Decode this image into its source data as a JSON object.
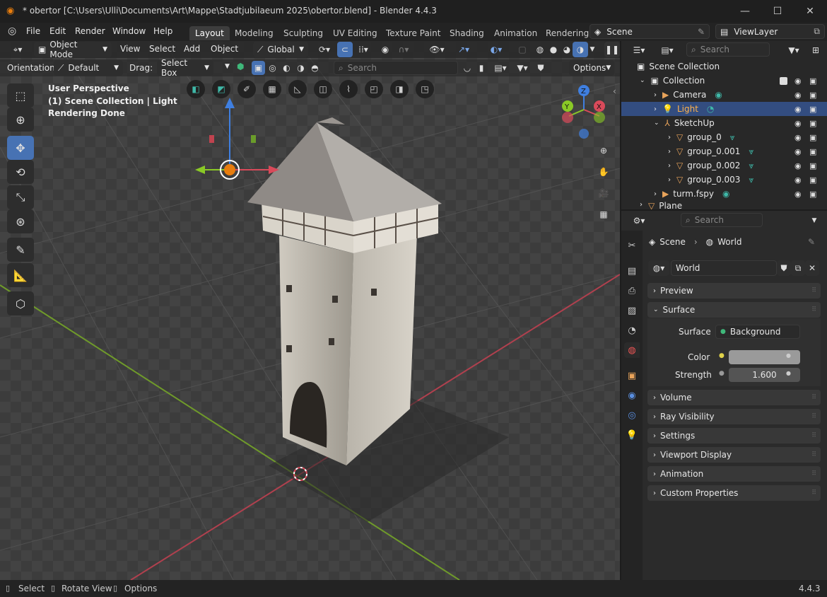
{
  "titlebar": {
    "title": "* obertor [C:\\Users\\Ulli\\Documents\\Art\\Mappe\\Stadtjubilaeum 2025\\obertor.blend] - Blender 4.4.3",
    "minimize": "—",
    "maximize": "☐",
    "close": "✕"
  },
  "menubar": {
    "items": [
      "File",
      "Edit",
      "Render",
      "Window",
      "Help"
    ],
    "workspaces": [
      "Layout",
      "Modeling",
      "Sculpting",
      "UV Editing",
      "Texture Paint",
      "Shading",
      "Animation",
      "Rendering"
    ],
    "scene": "Scene",
    "view_layer": "ViewLayer"
  },
  "vp_header": {
    "mode": "Object Mode",
    "menus": [
      "View",
      "Select",
      "Add",
      "Object"
    ],
    "transform": "Global",
    "search_placeholder": "Search"
  },
  "vp_header2": {
    "orientation_label": "Orientation:",
    "orientation_value": "Default",
    "drag_label": "Drag:",
    "drag_value": "Select Box",
    "search_placeholder": "Search",
    "options": "Options"
  },
  "viewport": {
    "perspective": "User Perspective",
    "collection": "(1) Scene Collection | Light",
    "status": "Rendering Done"
  },
  "outliner": {
    "search_placeholder": "Search",
    "items": [
      {
        "label": "Scene Collection"
      },
      {
        "label": "Collection"
      },
      {
        "label": "Camera"
      },
      {
        "label": "Light"
      },
      {
        "label": "SketchUp"
      },
      {
        "label": "group_0"
      },
      {
        "label": "group_0.001"
      },
      {
        "label": "group_0.002"
      },
      {
        "label": "group_0.003"
      },
      {
        "label": "turm.fspy"
      },
      {
        "label": "Plane"
      }
    ]
  },
  "properties": {
    "search_placeholder": "Search",
    "breadcrumb_scene": "Scene",
    "breadcrumb_world": "World",
    "world_name": "World",
    "panels": [
      "Preview",
      "Surface",
      "Volume",
      "Ray Visibility",
      "Settings",
      "Viewport Display",
      "Animation",
      "Custom Properties"
    ],
    "surface_label": "Surface",
    "surface_value": "Background",
    "color_label": "Color",
    "strength_label": "Strength",
    "strength_value": "1.600",
    "color_value": "#9a9a9a"
  },
  "statusbar": {
    "select": "Select",
    "rotate": "Rotate View",
    "options": "Options",
    "version": "4.4.3"
  },
  "colors": {
    "accent": "#4772b3",
    "selected_row": "#334d80",
    "x_axis": "#d94a5a",
    "y_axis": "#8ac926",
    "z_axis": "#3f7fe0"
  }
}
